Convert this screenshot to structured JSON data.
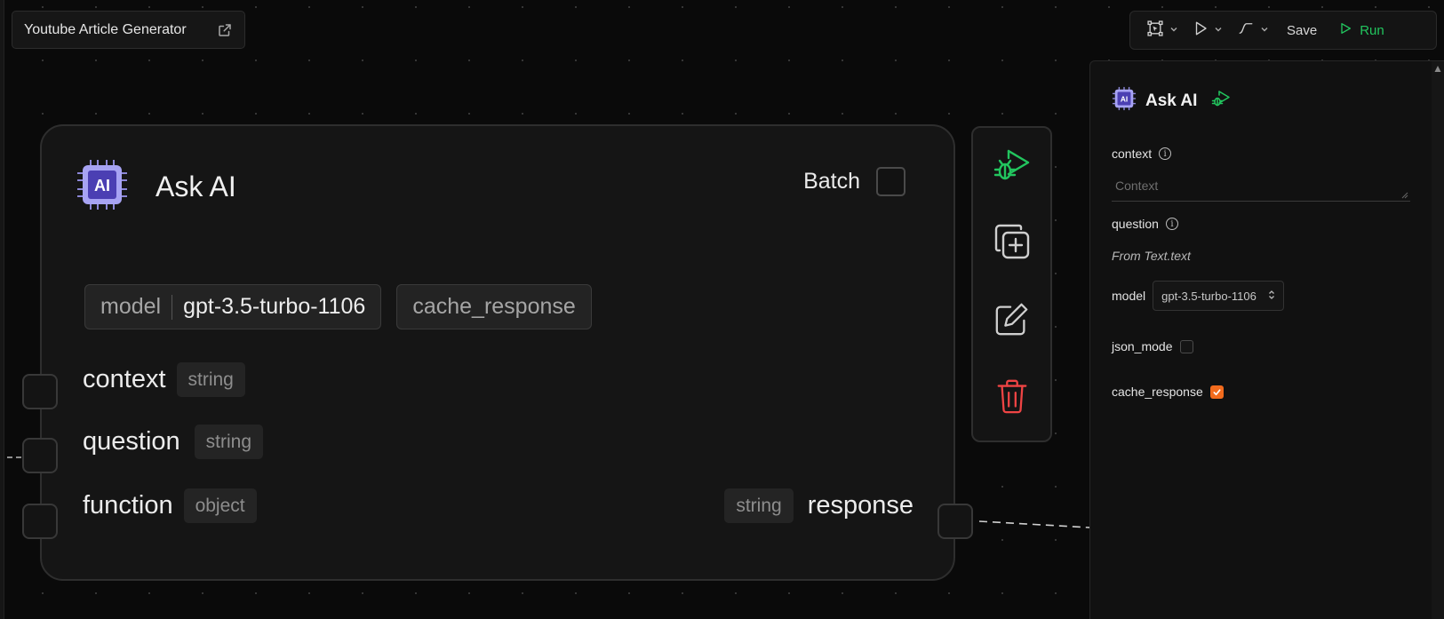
{
  "header": {
    "title": "Youtube Article Generator",
    "external_icon": "external-link-icon"
  },
  "toolbar": {
    "select_icon": "frame-select-icon",
    "pointer_icon": "pointer-icon",
    "edge_icon": "curve-edge-icon",
    "save_label": "Save",
    "run_label": "Run",
    "run_color": "#22c55e"
  },
  "node": {
    "title": "Ask AI",
    "icon": "ai-chip-icon",
    "batch_label": "Batch",
    "batch_checked": false,
    "chips": [
      {
        "key": "model",
        "value": "gpt-3.5-turbo-1106"
      },
      {
        "key": "cache_response"
      }
    ],
    "inputs": [
      {
        "name": "context",
        "type": "string"
      },
      {
        "name": "question",
        "type": "string"
      },
      {
        "name": "function",
        "type": "object"
      }
    ],
    "output": {
      "name": "response",
      "type": "string"
    }
  },
  "actions": [
    {
      "name": "debug-run",
      "icon": "bug-play-icon",
      "color": "#22c55e"
    },
    {
      "name": "duplicate",
      "icon": "copy-plus-icon",
      "color": "#cfcfcf"
    },
    {
      "name": "edit",
      "icon": "edit-icon",
      "color": "#cfcfcf"
    },
    {
      "name": "delete",
      "icon": "trash-icon",
      "color": "#ef4444"
    }
  ],
  "panel": {
    "title": "Ask AI",
    "context_label": "context",
    "context_placeholder": "Context",
    "question_label": "question",
    "question_source": "From Text.text",
    "model_label": "model",
    "model_value": "gpt-3.5-turbo-1106",
    "json_mode_label": "json_mode",
    "json_mode_checked": false,
    "cache_response_label": "cache_response",
    "cache_response_checked": true,
    "accent": "#f26b1d"
  }
}
